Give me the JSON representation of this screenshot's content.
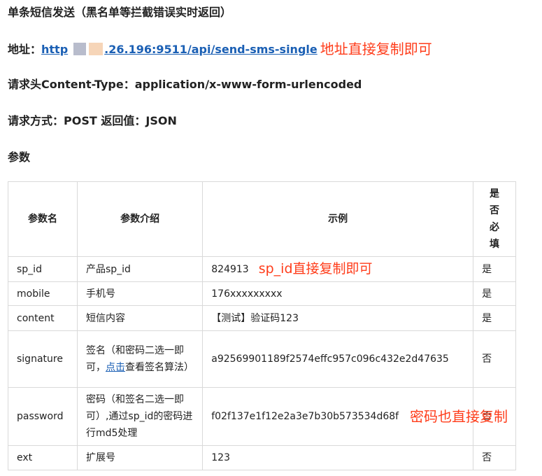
{
  "title": "单条短信发送（黑名单等拦截错误实时返回）",
  "address": {
    "label": "地址：",
    "url_start": "http",
    "url_end": ".26.196:9511/api/send-sms-single",
    "annotation": "地址直接复制即可"
  },
  "content_type": {
    "label": "请求头Content-Type：",
    "value": "application/x-www-form-urlencoded"
  },
  "method": {
    "label": "请求方式：",
    "value": "POST",
    "return_label": "返回值：",
    "return_value": "JSON"
  },
  "params_label": "参数",
  "table": {
    "headers": {
      "name": "参数名",
      "desc": "参数介绍",
      "example": "示例",
      "required_chars": [
        "是",
        "否",
        "必",
        "填"
      ]
    },
    "rows": [
      {
        "name": "sp_id",
        "desc": "产品sp_id",
        "example": "824913",
        "required": "是",
        "annotation": "sp_id直接复制即可"
      },
      {
        "name": "mobile",
        "desc": "手机号",
        "example": "176xxxxxxxxx",
        "required": "是"
      },
      {
        "name": "content",
        "desc": "短信内容",
        "example": "【测试】验证码123",
        "required": "是"
      },
      {
        "name": "signature",
        "desc_prefix": "签名（和密码二选一即可，",
        "desc_link": "点击",
        "desc_suffix": "查看签名算法）",
        "example": "a92569901189f2574effc957c096c432e2d47635",
        "required": "否"
      },
      {
        "name": "password",
        "desc": "密码（和签名二选一即可）,通过sp_id的密码进行md5处理",
        "example": "f02f137e1f12e2a3e7b30b573534d68f",
        "required": "否",
        "annotation": "密码也直接复制"
      },
      {
        "name": "ext",
        "desc": "扩展号",
        "example": "123",
        "required": "否"
      }
    ]
  },
  "colors": {
    "annotation": "#ff3c1a",
    "link": "#1a5fb4",
    "border": "#d9d9d9"
  }
}
